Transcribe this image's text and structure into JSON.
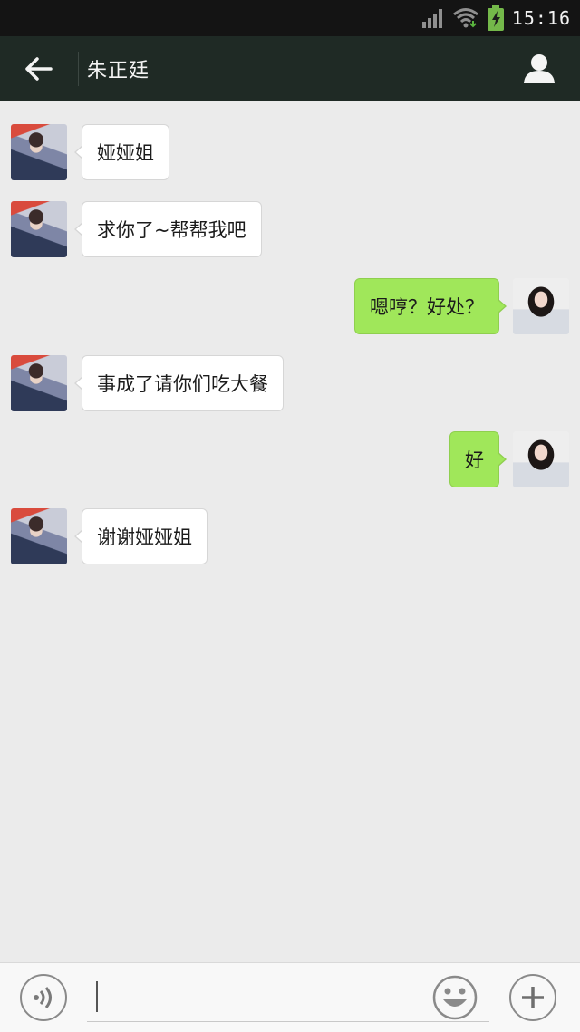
{
  "status_bar": {
    "time": "15:16",
    "icons": [
      "signal-icon",
      "wifi-icon",
      "battery-charging-icon"
    ]
  },
  "header": {
    "title": "朱正廷",
    "icons": [
      "back-arrow-icon",
      "profile-icon"
    ]
  },
  "messages": [
    {
      "side": "in",
      "text": "娅娅姐"
    },
    {
      "side": "in",
      "text": "求你了~帮帮我吧"
    },
    {
      "side": "out",
      "text": "嗯哼？好处？"
    },
    {
      "side": "in",
      "text": "事成了请你们吃大餐"
    },
    {
      "side": "out",
      "text": "好"
    },
    {
      "side": "in",
      "text": "谢谢娅娅姐"
    }
  ],
  "input_bar": {
    "value": "",
    "icons": [
      "voice-icon",
      "emoji-icon",
      "plus-icon"
    ]
  },
  "colors": {
    "status_bar": "#141414",
    "header": "#1f2a25",
    "chat_background": "#ebebeb",
    "outgoing_bubble": "#a0e75a",
    "incoming_bubble": "#ffffff"
  }
}
